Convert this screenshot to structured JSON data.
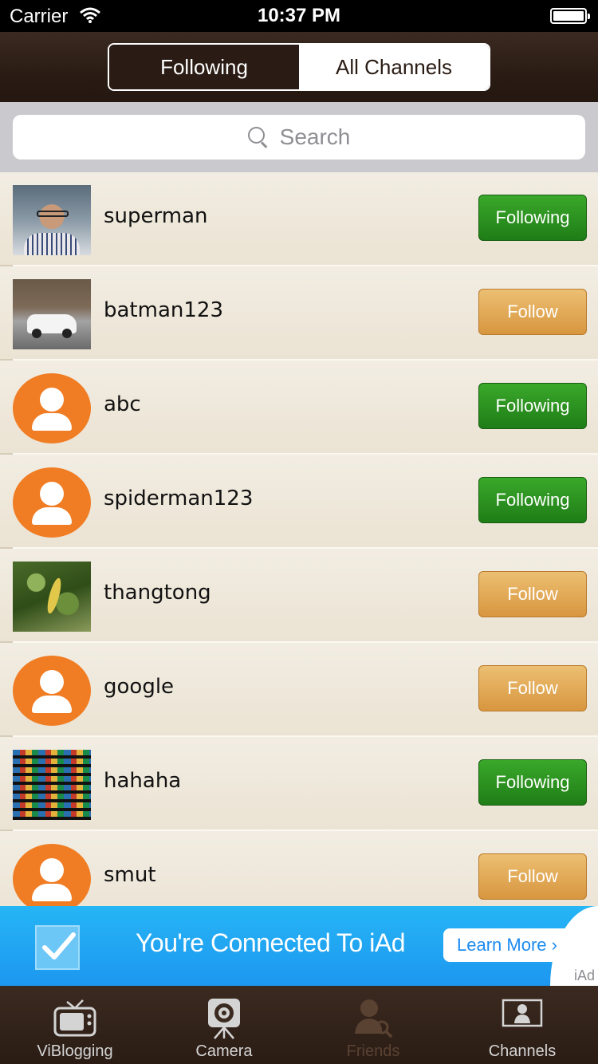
{
  "status_bar": {
    "carrier": "Carrier",
    "time": "10:37 PM"
  },
  "header": {
    "segments": [
      {
        "label": "Following",
        "selected": true
      },
      {
        "label": "All Channels",
        "selected": false
      }
    ]
  },
  "search": {
    "placeholder": "Search"
  },
  "channels": [
    {
      "name": "superman",
      "button": "Following",
      "state": "following",
      "avatar": "photo-face"
    },
    {
      "name": "batman123",
      "button": "Follow",
      "state": "follow",
      "avatar": "photo-car"
    },
    {
      "name": "abc",
      "button": "Following",
      "state": "following",
      "avatar": "default-user-icon"
    },
    {
      "name": "spiderman123",
      "button": "Following",
      "state": "following",
      "avatar": "default-user-icon"
    },
    {
      "name": "thangtong",
      "button": "Follow",
      "state": "follow",
      "avatar": "photo-leaf"
    },
    {
      "name": "google",
      "button": "Follow",
      "state": "follow",
      "avatar": "default-user-icon"
    },
    {
      "name": "hahaha",
      "button": "Following",
      "state": "following",
      "avatar": "photo-grid"
    },
    {
      "name": "smut",
      "button": "Follow",
      "state": "follow",
      "avatar": "default-user-icon"
    }
  ],
  "ad": {
    "title": "You're Connected To iAd",
    "cta": "Learn More ›",
    "badge": "iAd"
  },
  "tabbar": {
    "tabs": [
      {
        "label": "ViBlogging",
        "icon": "tv-icon"
      },
      {
        "label": "Camera",
        "icon": "camera-icon"
      },
      {
        "label": "Friends",
        "icon": "friends-icon",
        "active": true
      },
      {
        "label": "Channels",
        "icon": "channels-icon"
      }
    ]
  },
  "colors": {
    "following_button": "#2b9321",
    "follow_button": "#e2aa57",
    "default_avatar": "#f07d24",
    "ad_background": "#1d97f0"
  }
}
